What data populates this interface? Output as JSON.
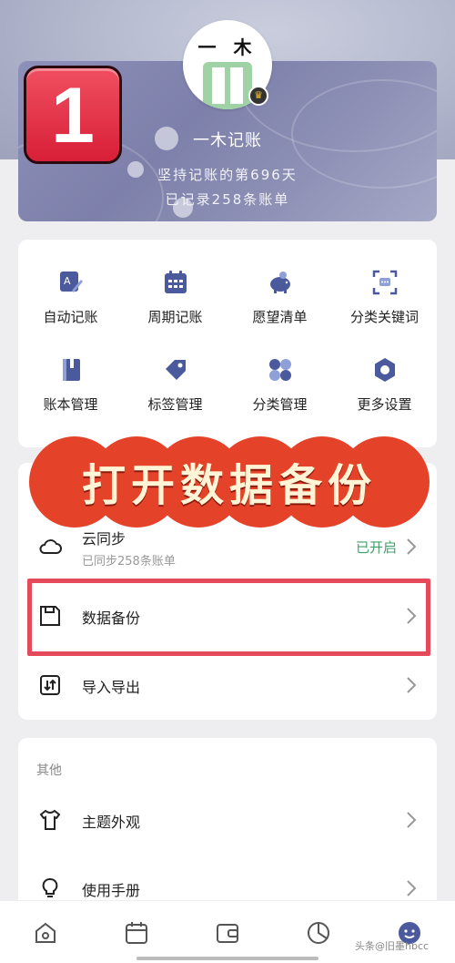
{
  "overlay": {
    "step_badge": "1",
    "banner_text": "打开数据备份"
  },
  "profile": {
    "logo_text": "一 木",
    "app_name": "一木记账",
    "days_line": "坚持记账的第696天",
    "records_line": "已记录258条账单"
  },
  "grid": {
    "items": [
      {
        "label": "自动记账",
        "icon": "auto-record-icon"
      },
      {
        "label": "周期记账",
        "icon": "calendar-icon"
      },
      {
        "label": "愿望清单",
        "icon": "piggy-bank-icon"
      },
      {
        "label": "分类关键词",
        "icon": "keyword-scan-icon"
      },
      {
        "label": "账本管理",
        "icon": "book-icon"
      },
      {
        "label": "标签管理",
        "icon": "tag-icon"
      },
      {
        "label": "分类管理",
        "icon": "category-grid-icon"
      },
      {
        "label": "更多设置",
        "icon": "settings-icon"
      }
    ]
  },
  "data_section": {
    "cloud_sync": {
      "title": "云同步",
      "subtitle": "已同步258条账单",
      "status": "已开启"
    },
    "backup": {
      "title": "数据备份"
    },
    "import_export": {
      "title": "导入导出"
    }
  },
  "other_section": {
    "label": "其他",
    "theme": {
      "title": "主题外观"
    },
    "manual": {
      "title": "使用手册"
    }
  },
  "watermark": "头条@旧墨hbcc",
  "colors": {
    "accent": "#4a5a9c",
    "enabled_status": "#3fa06a",
    "highlight": "#e54a5b",
    "banner": "#e5422a"
  }
}
